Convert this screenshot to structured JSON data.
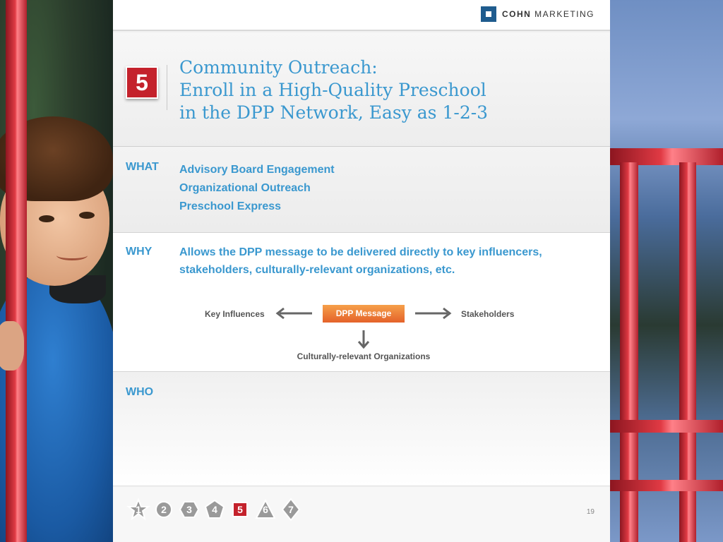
{
  "brand": {
    "bold": "COHN",
    "rest": "MARKETING"
  },
  "slide": {
    "number": "5",
    "title_lines": [
      "Community Outreach:",
      "Enroll in a High-Quality Preschool",
      "in the DPP Network, Easy as 1-2-3"
    ]
  },
  "sections": {
    "what": {
      "label": "WHAT",
      "items": [
        "Advisory Board Engagement",
        "Organizational Outreach",
        "Preschool Express"
      ]
    },
    "why": {
      "label": "WHY",
      "lines": [
        "Allows the DPP message to be delivered directly to key influencers,",
        "stakeholders, culturally-relevant organizations, etc."
      ]
    },
    "who": {
      "label": "WHO"
    }
  },
  "diagram": {
    "center": "DPP Message",
    "left": "Key Influences",
    "right": "Stakeholders",
    "bottom": "Culturally-relevant Organizations"
  },
  "nav": {
    "items": [
      "1",
      "2",
      "3",
      "4",
      "5",
      "6",
      "7"
    ],
    "active": "5"
  },
  "page_number": "19",
  "colors": {
    "accent_blue": "#3a98cf",
    "brand_red": "#c4222c",
    "message_orange": "#e4622a",
    "logo_blue": "#1f5c8e"
  }
}
